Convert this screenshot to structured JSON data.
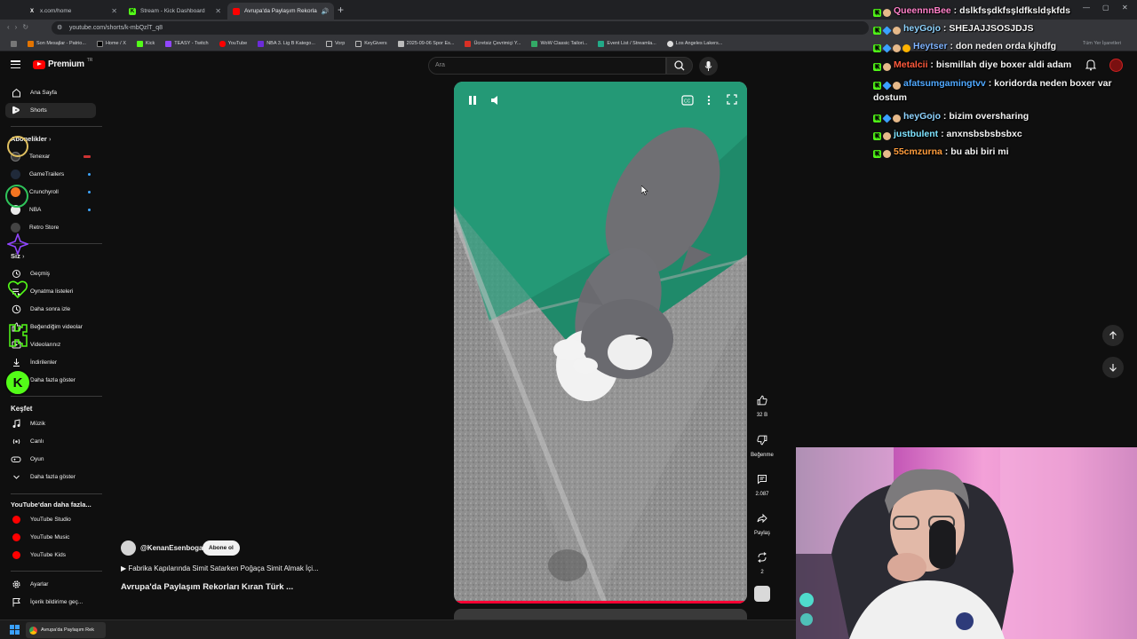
{
  "browser": {
    "tabs": [
      {
        "title": "x.com/home",
        "active": false
      },
      {
        "title": "Stream - Kick Dashboard",
        "active": false
      },
      {
        "title": "Avrupa'da Paylaşım Rekorla",
        "active": true
      }
    ],
    "url": "youtube.com/shorts/k-mbQzlT_q8",
    "bookmarks": [
      "Son Mesajlar - Patrio...",
      "Home / X",
      "Kick",
      "TEASY - Twitch",
      "YouTube",
      "NBA 3. Lig B Katego...",
      "Vorp",
      "KeyGivers",
      "2025-09-06 Spor Es...",
      "Ücretsiz Çevrimiçi Y...",
      "WoW Classic Tailori...",
      "Event List / Streamla...",
      "Los Angeles Lakers..."
    ],
    "all_bookmarks": "Tüm Yer İşaretleri"
  },
  "youtube": {
    "logo": "Premium",
    "logo_region": "TR",
    "search_placeholder": "Ara",
    "sidebar": {
      "top": [
        {
          "label": "Ana Sayfa",
          "icon": "home-icon"
        },
        {
          "label": "Shorts",
          "icon": "shorts-icon"
        }
      ],
      "subscriptions_title": "Abonelikler",
      "channels": [
        {
          "label": "Tenexar",
          "color": "#3b3b3b"
        },
        {
          "label": "GameTrailers",
          "color": "#202a3a"
        },
        {
          "label": "Crunchyroll",
          "color": "#f47521"
        },
        {
          "label": "NBA",
          "color": "#e9e9e9"
        },
        {
          "label": "Retro Store",
          "color": "#444"
        }
      ],
      "you_title": "Siz",
      "you_items": [
        {
          "label": "Geçmiş",
          "icon": "history-icon"
        },
        {
          "label": "Oynatma listeleri",
          "icon": "playlist-icon"
        },
        {
          "label": "Daha sonra izle",
          "icon": "clock-icon"
        },
        {
          "label": "Beğendiğim videolar",
          "icon": "like-icon"
        },
        {
          "label": "Videolarınız",
          "icon": "video-icon"
        },
        {
          "label": "İndirilenler",
          "icon": "download-icon"
        },
        {
          "label": "Daha fazla göster",
          "icon": "chevron-down-icon"
        }
      ],
      "explore_title": "Keşfet",
      "explore_items": [
        {
          "label": "Müzik",
          "icon": "music-icon"
        },
        {
          "label": "Canlı",
          "icon": "live-icon"
        },
        {
          "label": "Oyun",
          "icon": "gamepad-icon"
        },
        {
          "label": "Daha fazla göster",
          "icon": "chevron-down-icon"
        }
      ],
      "more_title": "YouTube'dan daha fazla...",
      "more_items": [
        {
          "label": "YouTube Studio"
        },
        {
          "label": "YouTube Music"
        },
        {
          "label": "YouTube Kids"
        }
      ],
      "bottom": [
        {
          "label": "Ayarlar",
          "icon": "gear-icon"
        },
        {
          "label": "İçerik bildirime geç...",
          "icon": "flag-icon"
        }
      ]
    },
    "short": {
      "channel": "@KenanEsenboga",
      "subscribe": "Abone ol",
      "music": "Fabrika Kapılarında Simit Satarken Poğaça Simit Almak İçi...",
      "title": "Avrupa'da Paylaşım Rekorları Kıran Türk ...",
      "likes": "32 B",
      "dislike": "Beğenme",
      "comments": "2.087",
      "share": "Paylaş",
      "remix": "2"
    }
  },
  "chat": [
    {
      "user": "QueennnBee",
      "color": "#ff80c8",
      "message": "dslkfsşdkfsşldfksldşkfds",
      "badges": [
        "kick",
        "face"
      ]
    },
    {
      "user": "heyGojo",
      "color": "#8fd4ff",
      "message": "SHEJAJJSOSJDJS",
      "badges": [
        "kick",
        "dia",
        "face"
      ]
    },
    {
      "user": "Heytser",
      "color": "#7fb4ff",
      "message": "don neden orda kjhdfg",
      "badges": [
        "kick",
        "dia",
        "face",
        "gold"
      ]
    },
    {
      "user": "Metalcii",
      "color": "#ff5a3c",
      "message": "bismillah diye boxer aldi adam",
      "badges": [
        "kick",
        "face"
      ]
    },
    {
      "user": "afatsumgamingtvv",
      "color": "#4fa8ff",
      "message": "koridorda neden boxer var",
      "message2": "dostum",
      "badges": [
        "kick",
        "dia",
        "face"
      ]
    },
    {
      "user": "heyGojo",
      "color": "#8fd4ff",
      "message": "bizim oversharing",
      "badges": [
        "kick",
        "dia",
        "face"
      ]
    },
    {
      "user": "justbulent",
      "color": "#7ee3ff",
      "message": "anxnsbsbsbsbxc",
      "badges": [
        "kick",
        "face"
      ]
    },
    {
      "user": "55cmzurna",
      "color": "#ff9c3c",
      "message": "bu abi biri mi",
      "badges": [
        "kick",
        "face"
      ]
    }
  ],
  "taskbar": {
    "app_title": "Avrupa'da Paylaşım Rek"
  }
}
